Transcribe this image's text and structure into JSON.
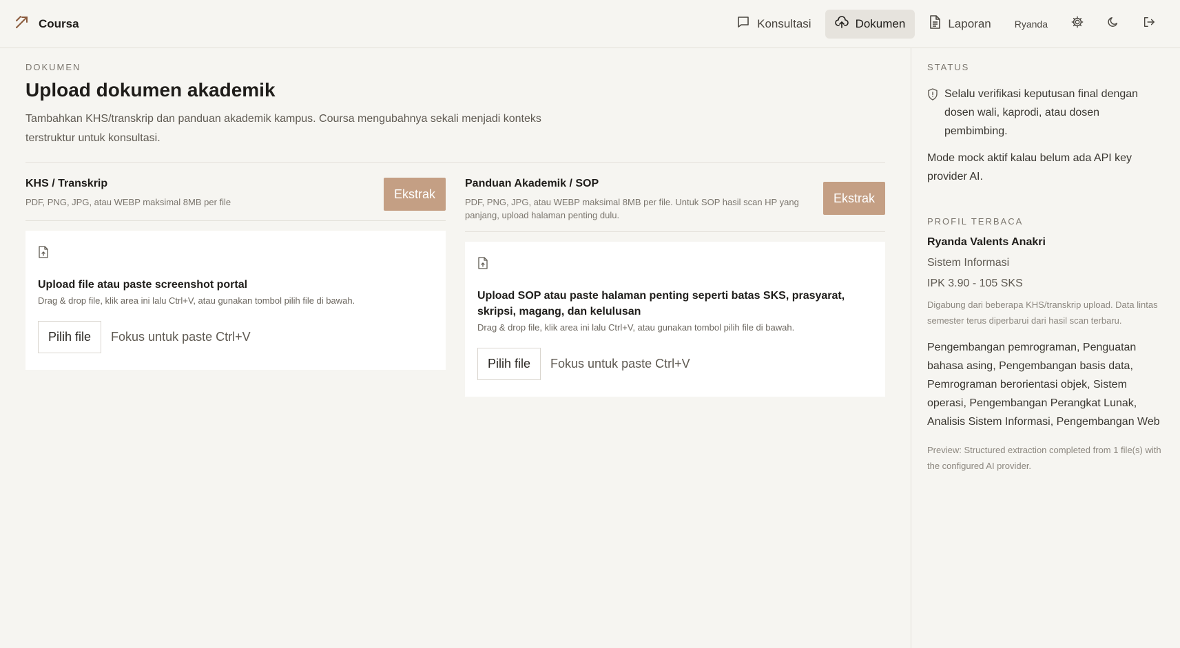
{
  "header": {
    "brand": "Coursa",
    "nav": [
      {
        "label": "Konsultasi",
        "icon": "chat-icon"
      },
      {
        "label": "Dokumen",
        "icon": "cloud-upload-icon",
        "active": true
      },
      {
        "label": "Laporan",
        "icon": "document-icon"
      }
    ],
    "user": "Ryanda",
    "icons": [
      "gear-icon",
      "moon-icon",
      "logout-icon"
    ]
  },
  "main": {
    "eyebrow": "DOKUMEN",
    "title": "Upload dokumen akademik",
    "description": "Tambahkan KHS/transkrip dan panduan akademik kampus. Coursa mengubahnya sekali menjadi konteks terstruktur untuk konsultasi.",
    "sections": [
      {
        "title": "KHS / Transkrip",
        "subtitle": "PDF, PNG, JPG, atau WEBP maksimal 8MB per file",
        "extract_label": "Ekstrak",
        "drop_title": "Upload file atau paste screenshot portal",
        "drop_subtitle": "Drag & drop file, klik area ini lalu Ctrl+V, atau gunakan tombol pilih file di bawah.",
        "pick_label": "Pilih file",
        "paste_hint": "Fokus untuk paste Ctrl+V"
      },
      {
        "title": "Panduan Akademik / SOP",
        "subtitle": "PDF, PNG, JPG, atau WEBP maksimal 8MB per file. Untuk SOP hasil scan HP yang panjang, upload halaman penting dulu.",
        "extract_label": "Ekstrak",
        "drop_title": "Upload SOP atau paste halaman penting seperti batas SKS, prasyarat, skripsi, magang, dan kelulusan",
        "drop_subtitle": "Drag & drop file, klik area ini lalu Ctrl+V, atau gunakan tombol pilih file di bawah.",
        "pick_label": "Pilih file",
        "paste_hint": "Fokus untuk paste Ctrl+V"
      }
    ]
  },
  "sidebar": {
    "status_label": "STATUS",
    "status_text": "Selalu verifikasi keputusan final dengan dosen wali, kaprodi, atau dosen pembimbing.",
    "mock_text": "Mode mock aktif kalau belum ada API key provider AI.",
    "profile_label": "PROFIL TERBACA",
    "profile_name": "Ryanda Valents Anakri",
    "program": "Sistem Informasi",
    "gpa": "IPK 3.90 - 105 SKS",
    "note": "Digabung dari beberapa KHS/transkrip upload. Data lintas semester terus diperbarui dari hasil scan terbaru.",
    "interests": "Pengembangan pemrograman, Penguatan bahasa asing, Pengembangan basis data, Pemrograman berorientasi objek, Sistem operasi, Pengembangan Perangkat Lunak, Analisis Sistem Informasi, Pengembangan Web",
    "preview": "Preview: Structured extraction completed from 1 file(s) with the configured AI provider."
  }
}
